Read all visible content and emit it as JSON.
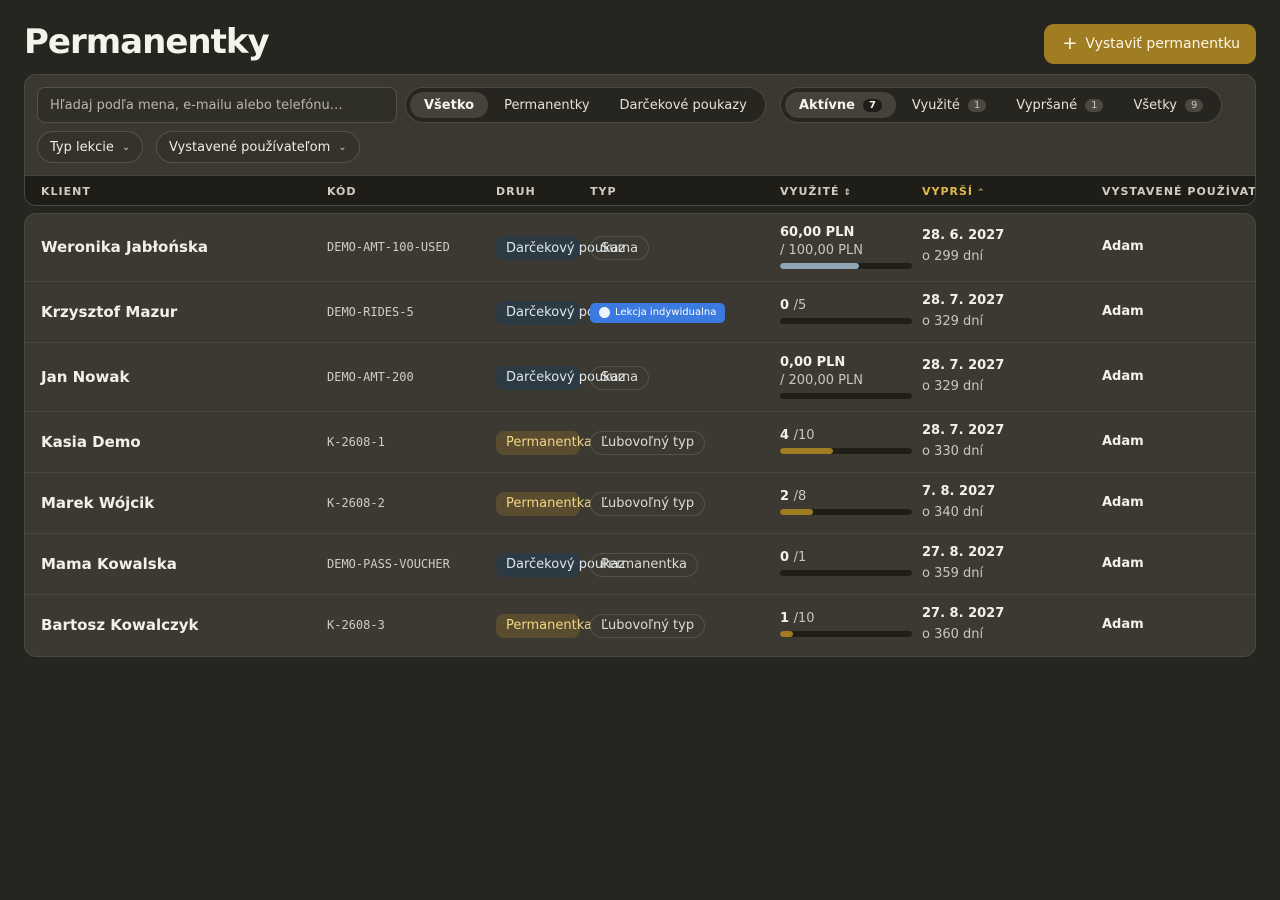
{
  "page": {
    "title": "Permanentky",
    "primary_action": "Vystaviť permanentku",
    "primary_icon": "plus-icon"
  },
  "filters": {
    "search_placeholder": "Hľadaj podľa mena, e-mailu alebo telefónu…",
    "kind_tabs": [
      {
        "label": "Všetko",
        "active": true
      },
      {
        "label": "Permanentky",
        "active": false
      },
      {
        "label": "Darčekové poukazy",
        "active": false
      }
    ],
    "status_tabs": [
      {
        "label": "Aktívne",
        "count": "7",
        "active": true
      },
      {
        "label": "Využité",
        "count": "1",
        "active": false
      },
      {
        "label": "Vypršané",
        "count": "1",
        "active": false
      },
      {
        "label": "Všetky",
        "count": "9",
        "active": false
      }
    ],
    "dropdowns": [
      {
        "label": "Typ lekcie"
      },
      {
        "label": "Vystavené používateľom"
      }
    ]
  },
  "table": {
    "columns": {
      "client": "KLIENT",
      "code": "KÓD",
      "kind": "DRUH",
      "type": "TYP",
      "used": "VYUŽITÉ",
      "expires": "VYPRŠÍ",
      "issued_by": "VYSTAVENÉ POUŽÍVATEĽOM"
    },
    "sorted_column": "expires",
    "rows": [
      {
        "client": "Weronika Jabłońska",
        "code": "DEMO-AMT-100-USED",
        "kind": "Darčekový poukaz",
        "kind_style": "gift",
        "type": "Suma",
        "type_style": "outline",
        "used_main": "60,00 PLN",
        "used_of": "",
        "used_sub": "/ 100,00 PLN",
        "progress": 0.6,
        "bar": "blue",
        "expires": "28. 6. 2027",
        "expires_in": "o 299 dní",
        "issued_by": "Adam"
      },
      {
        "client": "Krzysztof Mazur",
        "code": "DEMO-RIDES-5",
        "kind": "Darčekový poukaz",
        "kind_style": "gift",
        "type": "Lekcja indywidualna",
        "type_style": "lesson",
        "used_main": "0",
        "used_of": "/5",
        "used_sub": "",
        "progress": 0,
        "bar": "gold",
        "expires": "28. 7. 2027",
        "expires_in": "o 329 dní",
        "issued_by": "Adam"
      },
      {
        "client": "Jan Nowak",
        "code": "DEMO-AMT-200",
        "kind": "Darčekový poukaz",
        "kind_style": "gift",
        "type": "Suma",
        "type_style": "outline",
        "used_main": "0,00 PLN",
        "used_of": "",
        "used_sub": "/ 200,00 PLN",
        "progress": 0,
        "bar": "blue",
        "expires": "28. 7. 2027",
        "expires_in": "o 329 dní",
        "issued_by": "Adam"
      },
      {
        "client": "Kasia Demo",
        "code": "K-2608-1",
        "kind": "Permanentka",
        "kind_style": "pass",
        "type": "Ľubovoľný typ",
        "type_style": "outline",
        "used_main": "4",
        "used_of": "/10",
        "used_sub": "",
        "progress": 0.4,
        "bar": "gold",
        "expires": "28. 7. 2027",
        "expires_in": "o 330 dní",
        "issued_by": "Adam"
      },
      {
        "client": "Marek Wójcik",
        "code": "K-2608-2",
        "kind": "Permanentka",
        "kind_style": "pass",
        "type": "Ľubovoľný typ",
        "type_style": "outline",
        "used_main": "2",
        "used_of": "/8",
        "used_sub": "",
        "progress": 0.25,
        "bar": "gold",
        "expires": "7. 8. 2027",
        "expires_in": "o 340 dní",
        "issued_by": "Adam"
      },
      {
        "client": "Mama Kowalska",
        "code": "DEMO-PASS-VOUCHER",
        "kind": "Darčekový poukaz",
        "kind_style": "gift",
        "type": "Permanentka",
        "type_style": "outline",
        "used_main": "0",
        "used_of": "/1",
        "used_sub": "",
        "progress": 0,
        "bar": "gold",
        "expires": "27. 8. 2027",
        "expires_in": "o 359 dní",
        "issued_by": "Adam"
      },
      {
        "client": "Bartosz Kowalczyk",
        "code": "K-2608-3",
        "kind": "Permanentka",
        "kind_style": "pass",
        "type": "Ľubovoľný typ",
        "type_style": "outline",
        "used_main": "1",
        "used_of": "/10",
        "used_sub": "",
        "progress": 0.1,
        "bar": "gold",
        "expires": "27. 8. 2027",
        "expires_in": "o 360 dní",
        "issued_by": "Adam"
      }
    ]
  },
  "colors": {
    "background": "#262620",
    "accent": "#a07c22",
    "sorted_header": "#e0b94a",
    "gift_badge": "#2c3a44",
    "pass_badge": "#5a4c2e",
    "lesson_badge": "#3b7be0"
  }
}
